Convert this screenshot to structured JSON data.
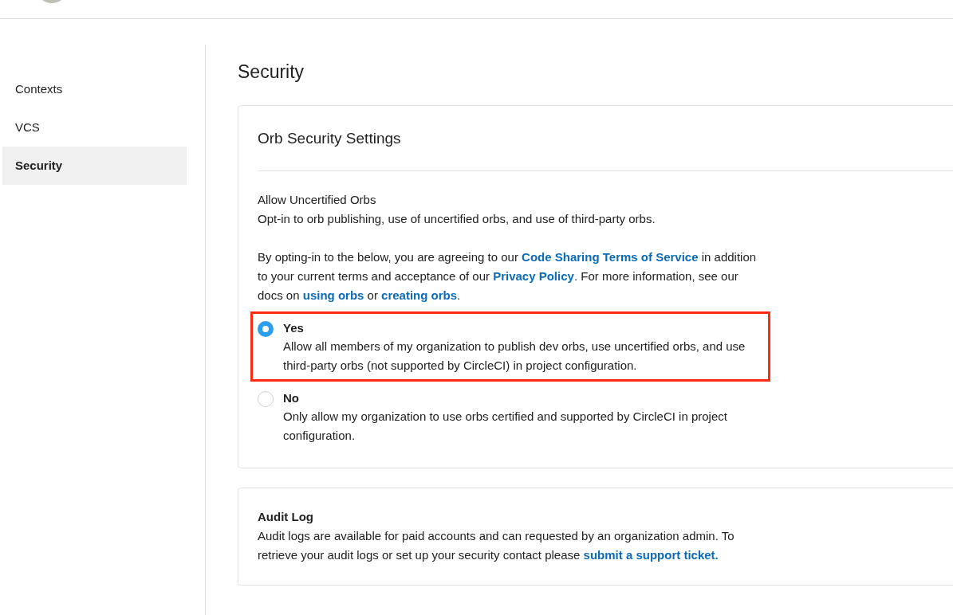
{
  "sidebar": {
    "items": [
      {
        "label": "Contexts",
        "selected": false
      },
      {
        "label": "VCS",
        "selected": false
      },
      {
        "label": "Security",
        "selected": true
      }
    ]
  },
  "page_title": "Security",
  "orb_card": {
    "title": "Orb Security Settings",
    "setting_label": "Allow Uncertified Orbs",
    "setting_description": "Opt-in to orb publishing, use of uncertified orbs, and use of third-party orbs.",
    "notice": [
      {
        "kind": "text",
        "text": "By opting-in to the below, you are agreeing to our "
      },
      {
        "kind": "link",
        "text": "Code Sharing Terms of Service"
      },
      {
        "kind": "text",
        "text": " in addition to your current terms and acceptance of our "
      },
      {
        "kind": "link",
        "text": "Privacy Policy"
      },
      {
        "kind": "text",
        "text": ". For more information, see our docs on "
      },
      {
        "kind": "link",
        "text": "using orbs"
      },
      {
        "kind": "text",
        "text": " or "
      },
      {
        "kind": "link",
        "text": "creating orbs"
      },
      {
        "kind": "text",
        "text": "."
      }
    ],
    "options": [
      {
        "label": "Yes",
        "description": "Allow all members of my organization to publish dev orbs, use uncertified orbs, and use third-party orbs (not supported by CircleCI) in project configuration.",
        "selected": true,
        "highlighted": true
      },
      {
        "label": "No",
        "description": "Only allow my organization to use orbs certified and supported by CircleCI in project configuration.",
        "selected": false,
        "highlighted": false
      }
    ]
  },
  "audit_card": {
    "title": "Audit Log",
    "text": [
      {
        "kind": "text",
        "text": "Audit logs are available for paid accounts and can requested by an organization admin. To retrieve your audit logs or set up your security contact please "
      },
      {
        "kind": "link",
        "text": "submit a support ticket."
      }
    ]
  }
}
